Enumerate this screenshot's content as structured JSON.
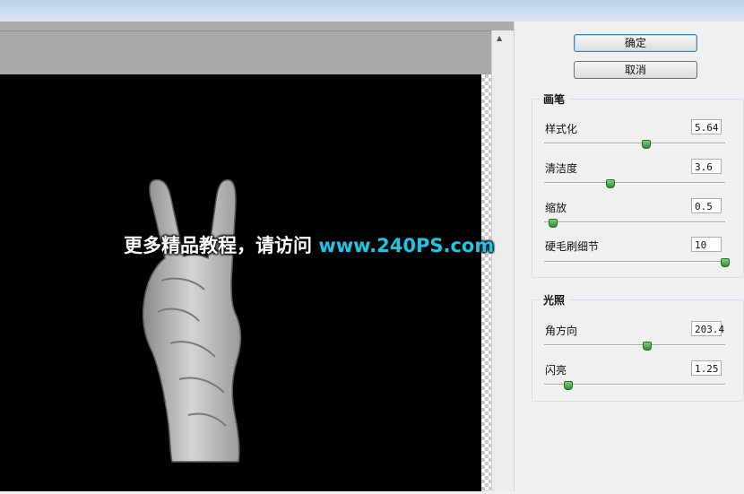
{
  "buttons": {
    "ok": "确定",
    "cancel": "取消"
  },
  "brush": {
    "title": "画笔",
    "stylization": {
      "label": "样式化",
      "value": "5.64",
      "level": 0.56
    },
    "cleanliness": {
      "label": "清洁度",
      "value": "3.6",
      "level": 0.36
    },
    "scale": {
      "label": "缩放",
      "value": "0.5",
      "level": 0.05
    },
    "bristle_detail": {
      "label": "硬毛刷细节",
      "value": "10",
      "level": 1.0
    }
  },
  "lighting": {
    "title": "光照",
    "angle": {
      "label": "角方向",
      "value": "203.4",
      "level": 0.56
    },
    "shine": {
      "label": "闪亮",
      "value": "1.25",
      "level": 0.13
    }
  },
  "watermark": {
    "text": "更多精品教程，请访问 ",
    "url": "www.240PS.com"
  },
  "colors": {
    "accent": "#1ec6e6",
    "thumb": "#3aa03a"
  }
}
